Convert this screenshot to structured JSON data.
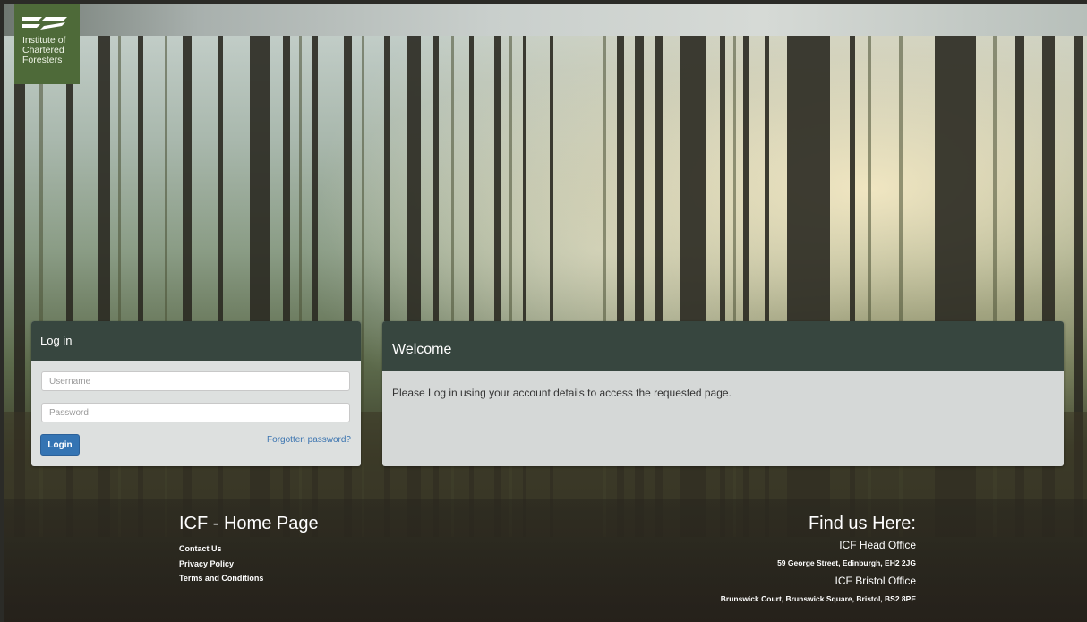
{
  "brand": {
    "name_line1": "Institute of",
    "name_line2": "Chartered",
    "name_line3": "Foresters",
    "color": "#4e6a39"
  },
  "login": {
    "title": "Log in",
    "username_placeholder": "Username",
    "password_placeholder": "Password",
    "login_label": "Login",
    "forgot_label": "Forgotten password?",
    "button_color": "#3474b3"
  },
  "welcome": {
    "title": "Welcome",
    "message": "Please Log in using your account details to access the requested page."
  },
  "footer": {
    "left_title": "ICF - Home Page",
    "links": [
      "Contact Us",
      "Privacy Policy",
      "Terms and Conditions"
    ],
    "right_title": "Find us Here:",
    "head_office_label": "ICF Head Office",
    "head_office_address": "59 George Street, Edinburgh, EH2 2JG",
    "bristol_office_label": "ICF Bristol Office",
    "bristol_office_address": "Brunswick Court, Brunswick Square, Bristol, BS2 8PE"
  },
  "colors": {
    "panel_header": "#37463f",
    "panel_body": "#dde0df"
  }
}
